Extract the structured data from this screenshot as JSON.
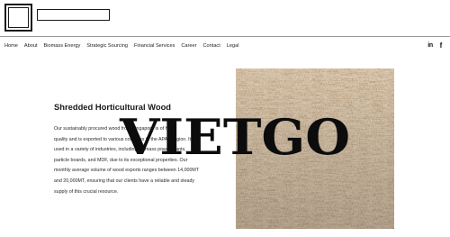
{
  "nav": {
    "items": [
      "Home",
      "About",
      "Biomass Energy",
      "Strategic Sourcing",
      "Financial Services",
      "Career",
      "Contact",
      "Legal"
    ]
  },
  "social": {
    "linkedin_label": "in",
    "facebook_label": "f"
  },
  "main": {
    "title": "Shredded Horticultural Wood",
    "body_lines": [
      "Our sustainably procured wood from Singapore is of high",
      "quality and is exported to various countries in the APAC region. It is",
      "used in a variety of industries, including biomass power plants,",
      "particle boards, and MDF, due to its exceptional properties. Our",
      "monthly average volume of wood exports ranges between 14,000MT",
      "and 20,000MT, ensuring that our clients have a reliable and steady",
      "supply of this crucial resource."
    ]
  },
  "watermark": {
    "text": "VIETGO"
  },
  "colors": {
    "text": "#1c1c1c",
    "rule": "#9a9a9a",
    "photo_base": "#b69676"
  },
  "icons": [
    "linkedin-icon",
    "facebook-icon",
    "site-logo"
  ]
}
